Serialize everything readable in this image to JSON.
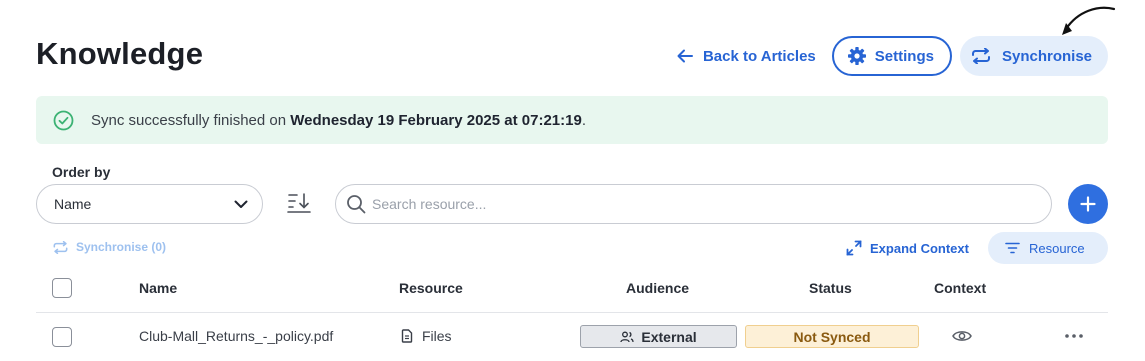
{
  "header": {
    "title": "Knowledge",
    "back_label": "Back to Articles",
    "settings_label": "Settings",
    "sync_label": "Synchronise"
  },
  "banner": {
    "prefix": "Sync successfully finished on ",
    "datetime": "Wednesday 19 February 2025 at 07:21:19",
    "suffix": "."
  },
  "controls": {
    "order_by_label": "Order by",
    "order_by_value": "Name",
    "search_placeholder": "Search resource...",
    "sync_count_label": "Synchronise (0)",
    "expand_label": "Expand Context",
    "resource_filter_label": "Resource"
  },
  "table": {
    "columns": [
      "Name",
      "Resource",
      "Audience",
      "Status",
      "Context"
    ],
    "rows": [
      {
        "name": "Club-Mall_Returns_-_policy.pdf",
        "resource": "Files",
        "audience": "External",
        "status": "Not Synced"
      }
    ]
  },
  "colors": {
    "accent": "#2764d4",
    "success_bg": "#e8f7ef",
    "success_icon": "#3bb273",
    "status_not_synced_bg": "#fdf0d7"
  },
  "icons": {
    "back": "arrow-left-icon",
    "settings": "gear-icon",
    "sync": "sync-icon",
    "success": "check-circle-icon",
    "dropdown": "chevron-down-icon",
    "sort": "sort-descending-icon",
    "search": "search-icon",
    "add": "plus-icon",
    "expand": "expand-icon",
    "filter": "filter-icon",
    "file": "file-icon",
    "audience": "users-icon",
    "context": "eye-icon",
    "more": "more-horizontal-icon"
  }
}
